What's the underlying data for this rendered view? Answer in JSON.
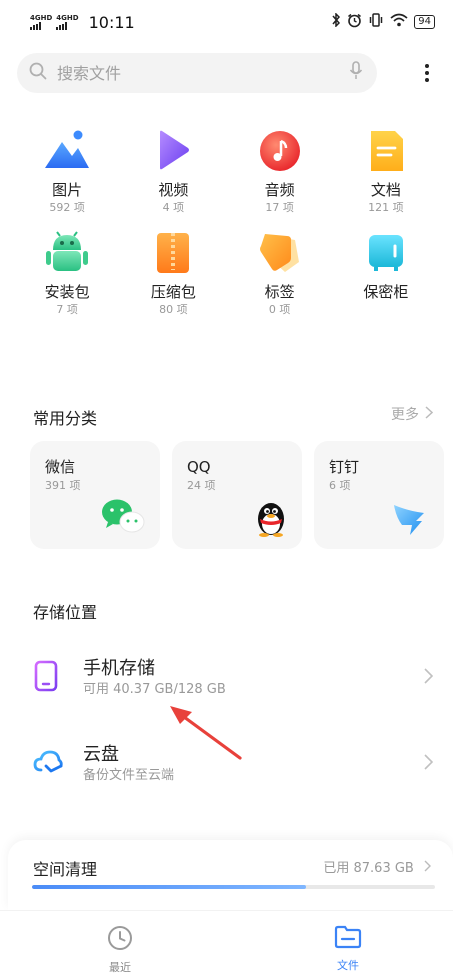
{
  "status_bar": {
    "sim1_label": "4GHD",
    "sim2_label": "4GHD",
    "time": "10:11",
    "battery": "94"
  },
  "search": {
    "placeholder": "搜索文件"
  },
  "categories": [
    {
      "name": "图片",
      "count": "592 项",
      "icon": "image-icon"
    },
    {
      "name": "视频",
      "count": "4 项",
      "icon": "video-icon"
    },
    {
      "name": "音频",
      "count": "17 项",
      "icon": "audio-icon"
    },
    {
      "name": "文档",
      "count": "121 项",
      "icon": "document-icon"
    },
    {
      "name": "安装包",
      "count": "7 项",
      "icon": "android-package-icon"
    },
    {
      "name": "压缩包",
      "count": "80 项",
      "icon": "archive-icon"
    },
    {
      "name": "标签",
      "count": "0 项",
      "icon": "tag-icon"
    },
    {
      "name": "保密柜",
      "count": "",
      "icon": "safe-icon"
    }
  ],
  "common": {
    "title": "常用分类",
    "more": "更多",
    "apps": [
      {
        "name": "微信",
        "count": "391 项",
        "icon": "wechat-icon"
      },
      {
        "name": "QQ",
        "count": "24 项",
        "icon": "qq-penguin-icon"
      },
      {
        "name": "钉钉",
        "count": "6 项",
        "icon": "dingtalk-icon"
      }
    ]
  },
  "storage": {
    "title": "存储位置",
    "items": [
      {
        "name": "手机存储",
        "sub": "可用 40.37 GB/128 GB",
        "icon": "phone-storage-icon"
      },
      {
        "name": "云盘",
        "sub": "备份文件至云端",
        "icon": "cloud-icon"
      }
    ]
  },
  "cleanup": {
    "title": "空间清理",
    "used": "已用 87.63 GB",
    "used_fraction": 0.68
  },
  "nav": {
    "recent": "最近",
    "files": "文件"
  },
  "colors": {
    "accent": "#3b83f6",
    "arrow": "#e8413b"
  }
}
